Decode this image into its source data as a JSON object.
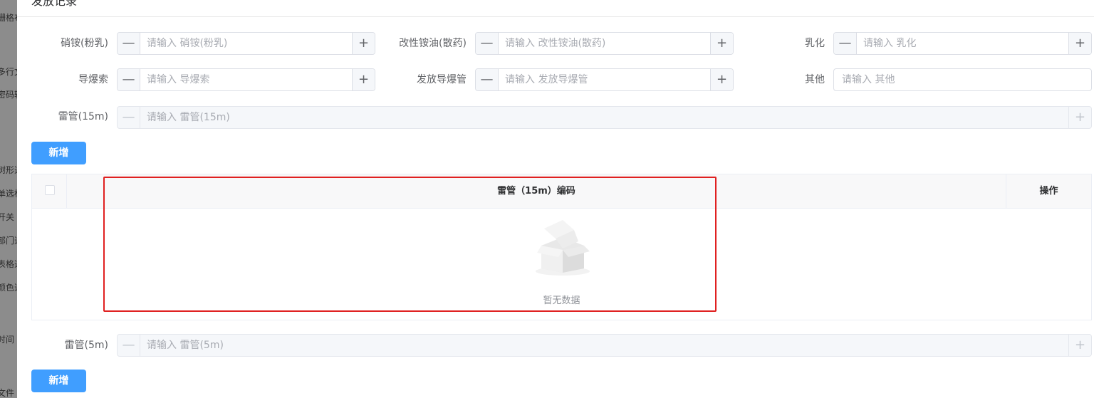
{
  "backdrop": {
    "fragments": [
      "栅格布",
      "多行文",
      "密码输",
      "树形选",
      "单选框",
      "开关",
      "部门选",
      "表格选",
      "颜色选",
      "时间",
      "文件"
    ]
  },
  "dialog": {
    "title": "发放记录"
  },
  "form": {
    "xiaoan": {
      "label": "硝铵(粉乳)",
      "placeholder": "请输入 硝铵(粉乳)"
    },
    "gaixing": {
      "label": "改性铵油(散药)",
      "placeholder": "请输入 改性铵油(散药)"
    },
    "ruhua": {
      "label": "乳化",
      "placeholder": "请输入 乳化"
    },
    "daobaosuo": {
      "label": "导爆索",
      "placeholder": "请输入 导爆索"
    },
    "daobaoguan": {
      "label": "发放导爆管",
      "placeholder": "请输入 发放导爆管"
    },
    "qita": {
      "label": "其他",
      "placeholder": "请输入 其他"
    },
    "leiguan15": {
      "label": "雷管(15m)",
      "placeholder": "请输入 雷管(15m)"
    },
    "leiguan5": {
      "label": "雷管(5m)",
      "placeholder": "请输入 雷管(5m)"
    },
    "minus": "—",
    "plus": "+"
  },
  "buttons": {
    "add": "新增",
    "add2": "新增"
  },
  "table": {
    "columns": [
      "雷管（15m）编码",
      "操作"
    ],
    "empty_text": "暂无数据"
  },
  "colors": {
    "primary": "#409eff",
    "highlight": "#e02020"
  }
}
